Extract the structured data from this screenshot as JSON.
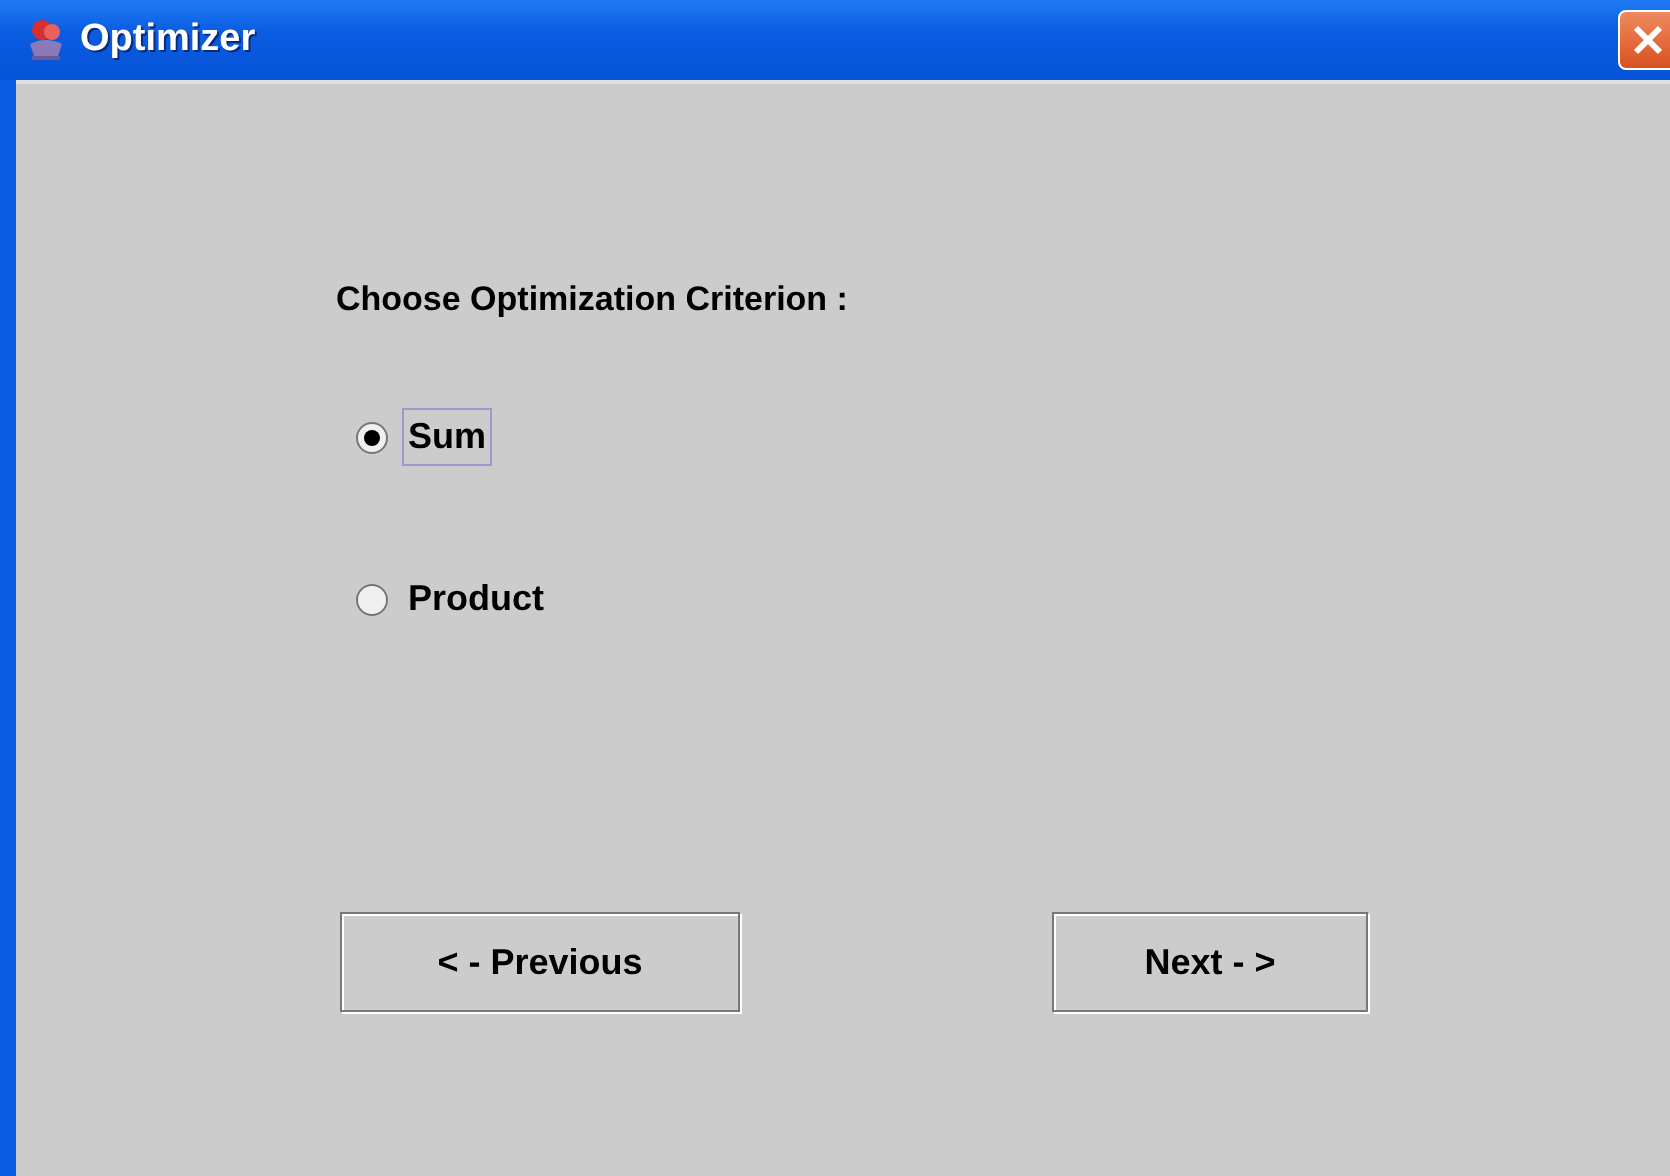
{
  "window": {
    "title": "Optimizer"
  },
  "prompt": "Choose Optimization Criterion :",
  "options": [
    {
      "label": "Sum",
      "selected": true,
      "focused": true
    },
    {
      "label": "Product",
      "selected": false,
      "focused": false
    }
  ],
  "buttons": [
    {
      "label": "< - Previous"
    },
    {
      "label": "Next - >"
    }
  ]
}
